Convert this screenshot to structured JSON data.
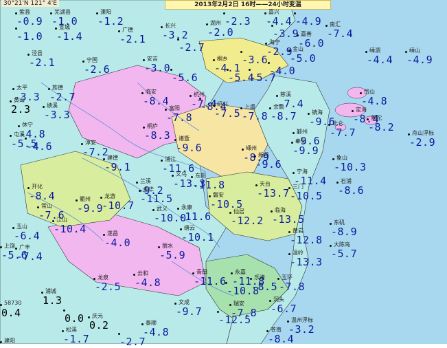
{
  "header": {
    "title": "2013年2月2日 16时——24小时变温",
    "coord_label": "30°21'N  121° 4'E"
  },
  "colors": {
    "sea": "#a8d8f0",
    "land_west": "#b9eaea",
    "region_pink": "#f3b7f0",
    "region_green": "#d8ee9e",
    "region_yellow": "#f7e6a3",
    "region_lightgreen": "#a6e1ae",
    "value_text": "#0a1a9c"
  },
  "stations": [
    {
      "name": "紫县",
      "value": "-0.9"
    },
    {
      "name": "芜湖县",
      "value": "-1.0"
    },
    {
      "name": "溧阳",
      "value": "-1.2"
    },
    {
      "name": "",
      "value": "-2.3"
    },
    {
      "name": "嘉兴",
      "value": "-4.4"
    },
    {
      "name": "",
      "value": "-4.9"
    },
    {
      "name": "",
      "value": "-1.0"
    },
    {
      "name": "宣城",
      "value": "-1.4"
    },
    {
      "name": "广德",
      "value": "-2.1"
    },
    {
      "name": "长兴",
      "value": "-3.2"
    },
    {
      "name": "",
      "value": "-2.7"
    },
    {
      "name": "湖州",
      "value": "-2.0"
    },
    {
      "name": "",
      "value": "-3.9"
    },
    {
      "name": "嘉善",
      "value": "-6.0"
    },
    {
      "name": "南汇",
      "value": "-7.4"
    },
    {
      "name": "泾县",
      "value": "-2.1"
    },
    {
      "name": "宁国",
      "value": "-2.6"
    },
    {
      "name": "安吉",
      "value": "-3.0"
    },
    {
      "name": "",
      "value": "-5.6"
    },
    {
      "name": "海宁",
      "value": "-2.9"
    },
    {
      "name": "桐乡",
      "value": "-4.1"
    },
    {
      "name": "",
      "value": "-3.6"
    },
    {
      "name": "",
      "value": "-5.4"
    },
    {
      "name": "",
      "value": "-5.7"
    },
    {
      "name": "",
      "value": "-4.0"
    },
    {
      "name": "金山",
      "value": "-5.0"
    },
    {
      "name": "嵊泗",
      "value": "-4.4"
    },
    {
      "name": "嵊山",
      "value": "-4.9"
    },
    {
      "name": "太平",
      "value": "-3.3"
    },
    {
      "name": "旌德",
      "value": "-2.7"
    },
    {
      "name": "黄山",
      "value": "2.3"
    },
    {
      "name": "绩溪",
      "value": "-3.3"
    },
    {
      "name": "临安",
      "value": "-8.4"
    },
    {
      "name": "杭州",
      "value": "-7.4"
    },
    {
      "name": "富阳",
      "value": "-7.8"
    },
    {
      "name": "",
      "value": "-8.4"
    },
    {
      "name": "绍兴",
      "value": "-7.5"
    },
    {
      "name": "上虞",
      "value": "-7.8"
    },
    {
      "name": "余姚",
      "value": "-8.7"
    },
    {
      "name": "慈溪",
      "value": "-7.4"
    },
    {
      "name": "岱山",
      "value": "-4.8"
    },
    {
      "name": "休宁",
      "value": "-4.8"
    },
    {
      "name": "屯溪",
      "value": "-5.5"
    },
    {
      "name": "",
      "value": "-4.6"
    },
    {
      "name": "桐庐",
      "value": "-8.3"
    },
    {
      "name": "镇海",
      "value": "-9.6"
    },
    {
      "name": "北仑",
      "value": "-7.7"
    },
    {
      "name": "定海",
      "value": "-8.4"
    },
    {
      "name": "普陀",
      "value": "-8.2"
    },
    {
      "name": "舟山浮标",
      "value": "-2.9"
    },
    {
      "name": "淳安",
      "value": "-7.2"
    },
    {
      "name": "建德",
      "value": "-9.1"
    },
    {
      "name": "诸暨",
      "value": "-9.6"
    },
    {
      "name": "嵊州",
      "value": "-8.9"
    },
    {
      "name": "新昌",
      "value": "-9.6"
    },
    {
      "name": "鄞州",
      "value": "-9.6"
    },
    {
      "name": "奉化",
      "value": "-9.9"
    },
    {
      "name": "象山",
      "value": "-10.3"
    },
    {
      "name": "浦江",
      "value": "-11.6"
    },
    {
      "name": "义乌",
      "value": "-13.3"
    },
    {
      "name": "东阳",
      "value": "-11.8"
    },
    {
      "name": "宁海",
      "value": "-11.4"
    },
    {
      "name": "石浦",
      "value": "-8.6"
    },
    {
      "name": "开化",
      "value": "-8.4"
    },
    {
      "name": "兰溪",
      "value": "-9.2"
    },
    {
      "name": "金华",
      "value": "-11.5"
    },
    {
      "name": "天台",
      "value": "-13.7"
    },
    {
      "name": "三门",
      "value": "-10.5"
    },
    {
      "name": "常山",
      "value": "-7.6"
    },
    {
      "name": "衢州",
      "value": "-9.9"
    },
    {
      "name": "龙游",
      "value": "-10.7"
    },
    {
      "name": "磐安",
      "value": "-10.5"
    },
    {
      "name": "江山",
      "value": "-10.4"
    },
    {
      "name": "武义",
      "value": "-10.0"
    },
    {
      "name": "永康",
      "value": "-11.6"
    },
    {
      "name": "仙居",
      "value": "-12.2"
    },
    {
      "name": "临海",
      "value": "-13.5"
    },
    {
      "name": "东矶",
      "value": "-8.9"
    },
    {
      "name": "玉山",
      "value": "-6.4"
    },
    {
      "name": "缙云",
      "value": "-10.1"
    },
    {
      "name": "黄岩",
      "value": "-12.8"
    },
    {
      "name": "上饶",
      "value": "-5.6"
    },
    {
      "name": "广丰",
      "value": "-7.4"
    },
    {
      "name": "遂昌",
      "value": "-4.0"
    },
    {
      "name": "丽水",
      "value": "-5.9"
    },
    {
      "name": "温岭",
      "value": "-13.3"
    },
    {
      "name": "大陈岛",
      "value": "-5.7"
    },
    {
      "name": "龙泉",
      "value": "-2.5"
    },
    {
      "name": "云和",
      "value": "-4.8"
    },
    {
      "name": "青田",
      "value": "-11.6"
    },
    {
      "name": "永嘉",
      "value": "-11.8"
    },
    {
      "name": "乐清",
      "value": "-8.5"
    },
    {
      "name": "玉环",
      "value": "-7.8"
    },
    {
      "name": "",
      "value": "-10.8"
    },
    {
      "name": "浦城",
      "value": "1.3"
    },
    {
      "name": "洞头",
      "value": "-6.7"
    },
    {
      "name": "58730",
      "value": "0.4"
    },
    {
      "name": "文成",
      "value": "-9.7"
    },
    {
      "name": "瑞安",
      "value": "-7.8"
    },
    {
      "name": "",
      "value": "-12.5"
    },
    {
      "name": "庆元",
      "value": "0.2"
    },
    {
      "name": "松溪",
      "value": "-1.7"
    },
    {
      "name": "温州浮标",
      "value": "-3.2"
    },
    {
      "name": "",
      "value": "0.0"
    },
    {
      "name": "泰顺",
      "value": "-4.8"
    },
    {
      "name": "",
      "value": "-2.7"
    },
    {
      "name": "苍南",
      "value": "-8.4"
    },
    {
      "name": "建阳",
      "value": ""
    }
  ]
}
